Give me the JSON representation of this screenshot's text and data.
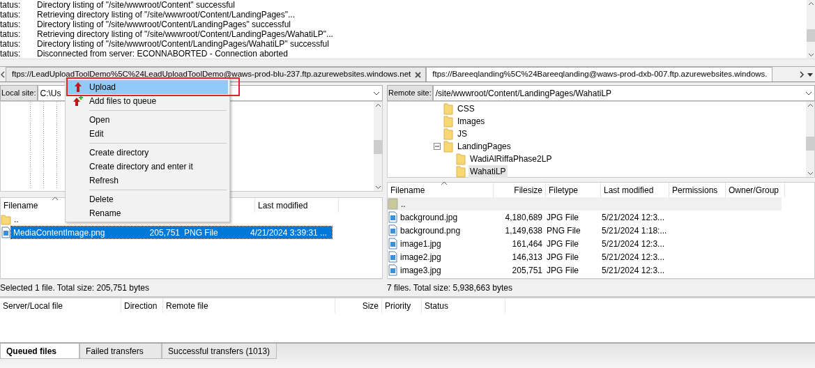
{
  "message_log": [
    {
      "label": "tatus:",
      "text": "Directory listing of \"/site/wwwroot/Content\" successful"
    },
    {
      "label": "tatus:",
      "text": "Retrieving directory listing of \"/site/wwwroot/Content/LandingPages\"..."
    },
    {
      "label": "tatus:",
      "text": "Directory listing of \"/site/wwwroot/Content/LandingPages\" successful"
    },
    {
      "label": "tatus:",
      "text": "Retrieving directory listing of \"/site/wwwroot/Content/LandingPages/WahatiLP\"..."
    },
    {
      "label": "tatus:",
      "text": "Directory listing of \"/site/wwwroot/Content/LandingPages/WahatiLP\" successful"
    },
    {
      "label": "tatus:",
      "text": "Disconnected from server: ECONNABORTED - Connection aborted"
    }
  ],
  "server_tabs": [
    {
      "label": "ftps://LeadUploadToolDemo%5C%24LeadUploadToolDemo@waws-prod-blu-237.ftp.azurewebsites.windows.net",
      "selected": false
    },
    {
      "label": "ftps://Bareeqlanding%5C%24Bareeqlanding@waws-prod-dxb-007.ftp.azurewebsites.windows.",
      "selected": true
    }
  ],
  "local": {
    "site_label": "Local site:",
    "path": "C:\\Us",
    "columns": [
      "Filename",
      "Last modified"
    ],
    "files": [
      {
        "kind": "parent",
        "name": ".."
      },
      {
        "kind": "file",
        "name": "MediaContentImage.png",
        "size": "205,751",
        "type": "PNG File",
        "modified": "4/21/2024 3:39:31 ...",
        "selected": true
      }
    ],
    "status": "Selected 1 file. Total size: 205,751 bytes"
  },
  "remote": {
    "site_label": "Remote site:",
    "path": "/site/wwwroot/Content/LandingPages/WahatiLP",
    "tree": [
      {
        "name": "CSS",
        "selected": false
      },
      {
        "name": "Images",
        "selected": false
      },
      {
        "name": "JS",
        "selected": false
      },
      {
        "name": "LandingPages",
        "selected": false,
        "expanded": true,
        "children": [
          {
            "name": "WadiAlRiffaPhase2LP",
            "selected": false
          },
          {
            "name": "WahatiLP",
            "selected": true
          }
        ]
      }
    ],
    "columns": [
      "Filename",
      "Filesize",
      "Filetype",
      "Last modified",
      "Permissions",
      "Owner/Group"
    ],
    "files": [
      {
        "kind": "parent",
        "name": ".."
      },
      {
        "kind": "file",
        "name": "background.jpg",
        "size": "4,180,689",
        "type": "JPG File",
        "modified": "5/21/2024 12:3..."
      },
      {
        "kind": "file",
        "name": "background.png",
        "size": "1,149,638",
        "type": "PNG File",
        "modified": "5/21/2024 1:18:..."
      },
      {
        "kind": "file",
        "name": "image1.jpg",
        "size": "161,464",
        "type": "JPG File",
        "modified": "5/21/2024 12:3..."
      },
      {
        "kind": "file",
        "name": "image2.jpg",
        "size": "146,313",
        "type": "JPG File",
        "modified": "5/21/2024 12:3..."
      },
      {
        "kind": "file",
        "name": "image3.jpg",
        "size": "205,751",
        "type": "JPG File",
        "modified": "5/21/2024 12:3..."
      }
    ],
    "status": "7 files. Total size: 5,938,663 bytes"
  },
  "queue": {
    "columns": [
      "Server/Local file",
      "Direction",
      "Remote file",
      "Size",
      "Priority",
      "Status"
    ]
  },
  "bottom_tabs": [
    {
      "label": "Queued files",
      "selected": true
    },
    {
      "label": "Failed transfers",
      "selected": false
    },
    {
      "label": "Successful transfers (1013)",
      "selected": false
    }
  ],
  "context_menu": [
    {
      "kind": "upload",
      "label": "Upload",
      "selected": true,
      "highlighted": true
    },
    {
      "kind": "queue",
      "label": "Add files to queue",
      "selected": false
    },
    {
      "kind": "separator"
    },
    {
      "kind": "item",
      "label": "Open",
      "selected": false
    },
    {
      "kind": "item",
      "label": "Edit",
      "selected": false
    },
    {
      "kind": "separator"
    },
    {
      "kind": "item",
      "label": "Create directory",
      "selected": false
    },
    {
      "kind": "item",
      "label": "Create directory and enter it",
      "selected": false
    },
    {
      "kind": "item",
      "label": "Refresh",
      "selected": false
    },
    {
      "kind": "separator"
    },
    {
      "kind": "item",
      "label": "Delete",
      "selected": false
    },
    {
      "kind": "item",
      "label": "Rename",
      "selected": false
    }
  ]
}
